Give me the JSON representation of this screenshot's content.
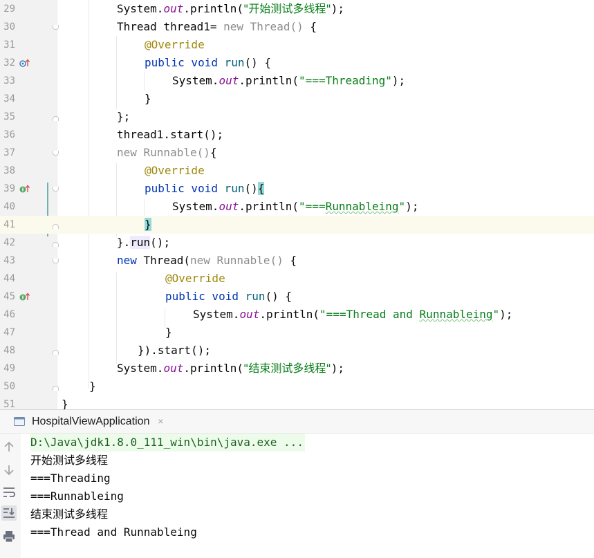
{
  "editor": {
    "line_numbers": [
      "29",
      "30",
      "31",
      "32",
      "33",
      "34",
      "35",
      "36",
      "37",
      "38",
      "39",
      "40",
      "41",
      "42",
      "43",
      "44",
      "45",
      "46",
      "47",
      "48",
      "49",
      "50",
      "51"
    ],
    "lines": {
      "l29": {
        "pre": "System.",
        "field": "out",
        "mid": ".println(",
        "str": "\"开始测试多线程\"",
        "post": ");"
      },
      "l30": {
        "a": "Thread thread1= ",
        "b": "new Thread()",
        "c": " {"
      },
      "l31": {
        "ann": "@Override"
      },
      "l32": {
        "kw": "public void ",
        "m": "run",
        "post": "() {"
      },
      "l33": {
        "pre": "System.",
        "field": "out",
        "mid": ".println(",
        "str": "\"===Threading\"",
        "post": ");"
      },
      "l34": {
        "text": "}"
      },
      "l35": {
        "text": "};"
      },
      "l36": {
        "text": "thread1.start();"
      },
      "l37": {
        "grey": "new Runnable()",
        "post": "{"
      },
      "l38": {
        "ann": "@Override"
      },
      "l39": {
        "kw": "public void ",
        "m": "run",
        "post": "()",
        "brace": "{"
      },
      "l40": {
        "pre": "System.",
        "field": "out",
        "mid": ".println(",
        "str_a": "\"===",
        "str_typo": "Runnableing",
        "str_b": "\"",
        "post": ");"
      },
      "l41": {
        "brace": "}"
      },
      "l42": {
        "a": "}.",
        "run": "run",
        "b": "();"
      },
      "l43": {
        "kw": "new ",
        "a": "Thread(",
        "grey": "new Runnable()",
        "b": " {"
      },
      "l44": {
        "ann": "@Override"
      },
      "l45": {
        "kw": "public void ",
        "m": "run",
        "post": "() {"
      },
      "l46": {
        "pre": "System.",
        "field": "out",
        "mid": ".println(",
        "str_a": "\"===Thread and ",
        "str_typo": "Runnableing",
        "str_b": "\"",
        "post": ");"
      },
      "l47": {
        "text": "}"
      },
      "l48": {
        "text": "}).start();"
      },
      "l49": {
        "pre": "System.",
        "field": "out",
        "mid": ".println(",
        "str": "\"结束测试多线程\"",
        "post": ");"
      },
      "l50": {
        "text": "}"
      },
      "l51": {
        "text": "}"
      }
    }
  },
  "run_panel": {
    "tab_label": "HospitalViewApplication",
    "tab_close": "×",
    "command": "D:\\Java\\jdk1.8.0_111_win\\bin\\java.exe ...",
    "output": [
      "开始测试多线程",
      "===Threading",
      "===Runnableing",
      "结束测试多线程",
      "===Thread and Runnableing"
    ]
  },
  "colors": {
    "keyword": "#0033b3",
    "string": "#067d17",
    "field": "#871094",
    "annotation": "#9e880d",
    "method": "#00627a",
    "current_line": "#fcfaed",
    "brace_match": "#93d9d9"
  },
  "icons": [
    "override-gutter-icon",
    "implement-gutter-icon",
    "fold-marker-icon",
    "run-config-icon",
    "close-icon",
    "up-arrow-icon",
    "down-arrow-icon",
    "soft-wrap-icon",
    "scroll-to-end-icon",
    "print-icon"
  ]
}
